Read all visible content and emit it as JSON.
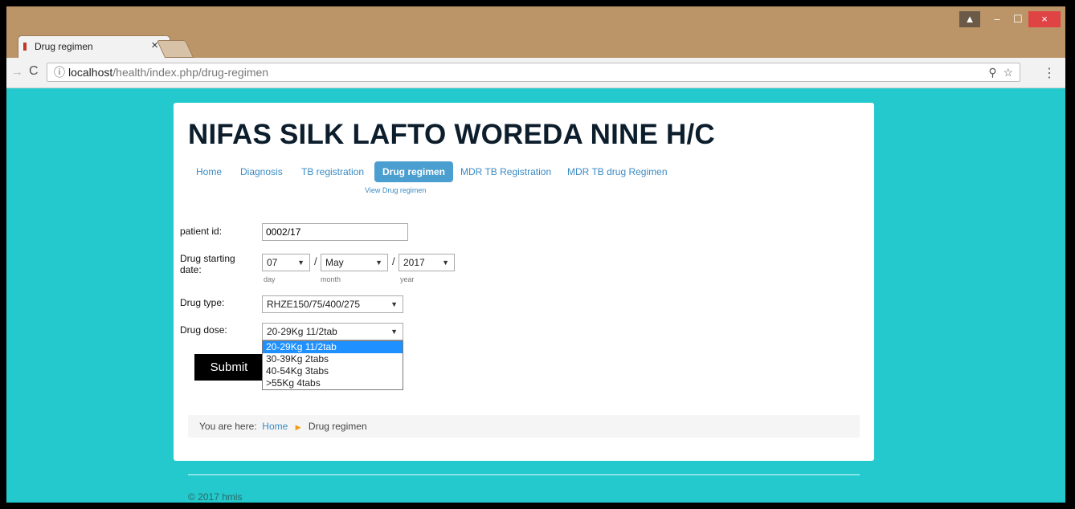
{
  "browser": {
    "tab_title": "Drug regimen",
    "tab_close": "×",
    "url_host": "localhost",
    "url_path": "/health/index.php/drug-regimen",
    "info_icon": "ⓘ",
    "zoom_icon": "⚲",
    "star_icon": "☆",
    "menu_icon": "⋮",
    "back_icon": "→",
    "reload_icon": "C",
    "win_user": "▲",
    "win_min": "–",
    "win_max": "☐",
    "win_close": "×"
  },
  "header": {
    "site_title": "NIFAS SILK LAFTO WOREDA NINE H/C"
  },
  "nav": {
    "items": [
      {
        "label": "Home"
      },
      {
        "label": "Diagnosis"
      },
      {
        "label": "TB registration"
      },
      {
        "label": "Drug regimen"
      },
      {
        "label": "MDR TB Registration"
      },
      {
        "label": "MDR TB drug Regimen"
      }
    ],
    "sub_item": "View Drug regimen"
  },
  "form": {
    "patient_id_label": "patient id:",
    "patient_id_value": "0002/17",
    "start_date_label": "Drug starting date:",
    "day_value": "07",
    "month_value": "May",
    "year_value": "2017",
    "slash": "/",
    "day_hint": "day",
    "month_hint": "month",
    "year_hint": "year",
    "drug_type_label": "Drug type:",
    "drug_type_value": "RHZE150/75/400/275",
    "drug_dose_label": "Drug dose:",
    "drug_dose_value": "20-29Kg 11/2tab",
    "dose_options": [
      "20-29Kg 11/2tab",
      "30-39Kg 2tabs",
      "40-54Kg 3tabs",
      ">55Kg 4tabs"
    ],
    "submit_label": "Submit",
    "arrow": "▼"
  },
  "breadcrumb": {
    "prefix": "You are here:",
    "home": "Home",
    "separator": "▶",
    "current": "Drug regimen"
  },
  "footer": {
    "copyright": "© 2017 hmis"
  }
}
